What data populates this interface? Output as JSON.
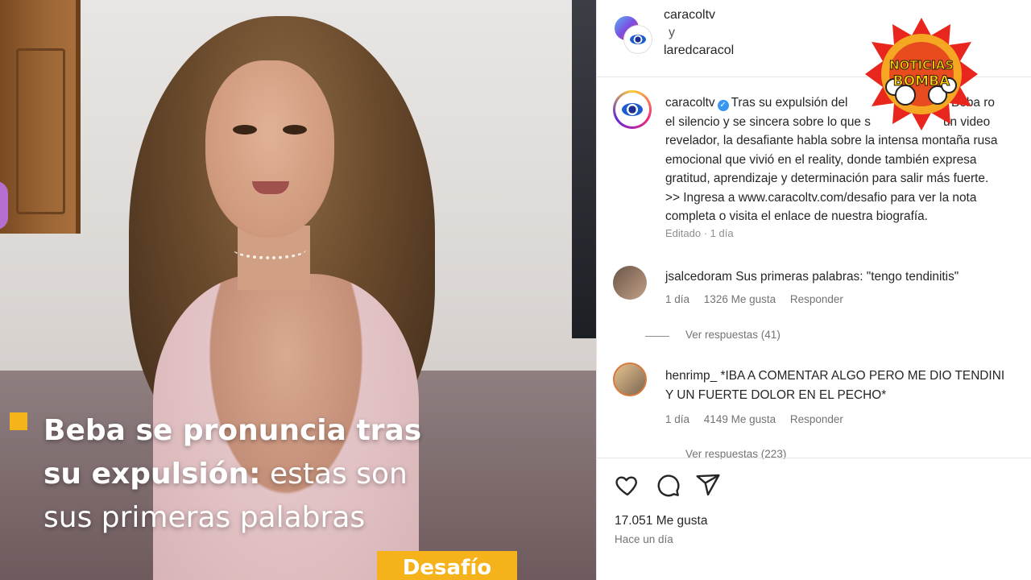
{
  "video": {
    "caption_bold": "Beba se pronuncia tras su expulsión:",
    "caption_rest": "estas son sus primeras palabras",
    "caption_line1": "Beba se pronuncia tras",
    "caption_line2_bold": "su expulsión:",
    "caption_line2_rest": " estas son",
    "caption_line3": "sus primeras palabras",
    "tag": "Desafío"
  },
  "collab": {
    "user1": "caracoltv",
    "connector": "y",
    "user2": "laredcaracol"
  },
  "post": {
    "username": "caracoltv",
    "lines": [
      "Tras su expulsión del",
      "el silencio y se sincera sobre lo que s",
      "revelador, la desafiante habla sobre la intensa montaña rusa",
      "emocional que vivió en el reality, donde también expresa",
      "gratitud, aprendizaje y determinación para salir más fuerte.",
      ">> Ingresa a www.caracoltv.com/desafio para ver la nota",
      "completa o visita el enlace de nuestra biografía."
    ],
    "line1_tail": ", Beba ro",
    "line2_tail": "un video",
    "meta": "Editado · 1 día"
  },
  "comments": [
    {
      "username": "jsalcedoram",
      "text": "Sus primeras palabras: \"tengo tendinitis\"",
      "line2": "",
      "age": "1 día",
      "likes": "1326 Me gusta",
      "reply": "Responder",
      "replies": "Ver respuestas (41)"
    },
    {
      "username": "henrimp_",
      "text": "*IBA A COMENTAR ALGO PERO ME DIO TENDINI",
      "line2": "Y UN FUERTE DOLOR EN EL PECHO*",
      "age": "1 día",
      "likes": "4149 Me gusta",
      "reply": "Responder",
      "replies": "Ver respuestas (223)"
    }
  ],
  "footer": {
    "likes": "17.051 Me gusta",
    "time": "Hace un día"
  },
  "badge": {
    "line1": "NOTICIAS",
    "line2": "BOMBA",
    "colors": {
      "burst": "#e8261d",
      "ray": "#f5a623",
      "text": "#ffd200",
      "dark": "#2b1e10"
    }
  },
  "icons": [
    "heart-icon",
    "comment-icon",
    "share-icon"
  ]
}
